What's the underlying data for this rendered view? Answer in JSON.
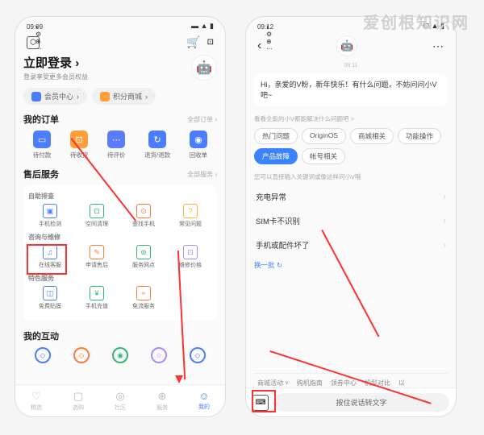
{
  "watermark": "爱创根知识网",
  "phone1": {
    "status": {
      "time": "09:09",
      "icons": "◐ ⚙ ⊕ ⋯"
    },
    "login": {
      "title": "立即登录",
      "arrow": "›",
      "subtitle": "登录享受更多会员权益"
    },
    "pills": {
      "member": "会员中心",
      "points": "积分商城",
      "arrow": "›"
    },
    "orders": {
      "title": "我的订单",
      "more": "全部订单 ›",
      "items": [
        {
          "label": "待付款",
          "icon": "▭",
          "bg": "#4a7eff"
        },
        {
          "label": "待收货",
          "icon": "⊡",
          "bg": "#ff9f3a"
        },
        {
          "label": "待评价",
          "icon": "⋯",
          "bg": "#5b7cff"
        },
        {
          "label": "退货/退款",
          "icon": "↻",
          "bg": "#4a7eff"
        },
        {
          "label": "回收单",
          "icon": "◉",
          "bg": "#4a7eff"
        }
      ]
    },
    "service": {
      "title": "售后服务",
      "more": "全部服务 ›",
      "groups": [
        {
          "t": "自助排查",
          "items": [
            {
              "label": "手机检测",
              "icon": "▣",
              "c": "#4a7eff"
            },
            {
              "label": "空间清理",
              "icon": "⊡",
              "c": "#2eb872"
            },
            {
              "label": "查找手机",
              "icon": "⊙",
              "c": "#ff7a3a"
            },
            {
              "label": "常见问题",
              "icon": "?",
              "c": "#ffb73a"
            }
          ]
        },
        {
          "t": "咨询与维修",
          "items": [
            {
              "label": "在线客服",
              "icon": "♫",
              "c": "#4a7eff"
            },
            {
              "label": "申请售后",
              "icon": "✎",
              "c": "#ff7a3a"
            },
            {
              "label": "服务网点",
              "icon": "⊚",
              "c": "#2eb872"
            },
            {
              "label": "维修价格",
              "icon": "⊡",
              "c": "#a78bff"
            }
          ]
        },
        {
          "t": "特色服务",
          "items": [
            {
              "label": "免费贴膜",
              "icon": "◫",
              "c": "#4a7eff"
            },
            {
              "label": "手机充值",
              "icon": "¥",
              "c": "#2eb872"
            },
            {
              "label": "免流服务",
              "icon": "≈",
              "c": "#ff7a3a"
            }
          ]
        }
      ]
    },
    "interact": {
      "title": "我的互动",
      "items": [
        {
          "c": "#4a7eff",
          "i": "◇"
        },
        {
          "c": "#ff7a3a",
          "i": "◇"
        },
        {
          "c": "#2eb872",
          "i": "◉"
        },
        {
          "c": "#a78bff",
          "i": "☆"
        },
        {
          "c": "#4a7eff",
          "i": "◇"
        }
      ]
    },
    "nav": [
      {
        "label": "精选",
        "icon": "♡"
      },
      {
        "label": "选购",
        "icon": "▢"
      },
      {
        "label": "社区",
        "icon": "◎"
      },
      {
        "label": "服务",
        "icon": "⊕"
      },
      {
        "label": "我的",
        "icon": "☺"
      }
    ]
  },
  "phone2": {
    "status": {
      "time": "09:12",
      "icons": "◐ ⚙ ⊕ ⋯"
    },
    "timestamp": "09:11",
    "greeting": "Hi，亲爱的V粉，新年快乐！有什么问题，不妨问问小V吧~",
    "hint1": "看看全能的小V都能解决什么问题吧 >",
    "chips": [
      "热门问题",
      "OriginOS",
      "商城相关",
      "功能操作",
      "产品故障",
      "帐号相关"
    ],
    "active_chip": 4,
    "hint2": "您可以直接输入关键词或像这样问小V哦",
    "questions": [
      "充电异常",
      "SIM卡不识别",
      "手机或配件坏了"
    ],
    "refresh": "换一批 ↻",
    "bottom_tags": [
      "商城活动",
      "购机指南",
      "领券中心",
      "机型对比",
      "以"
    ],
    "voice_input": "按住说话转文字"
  }
}
